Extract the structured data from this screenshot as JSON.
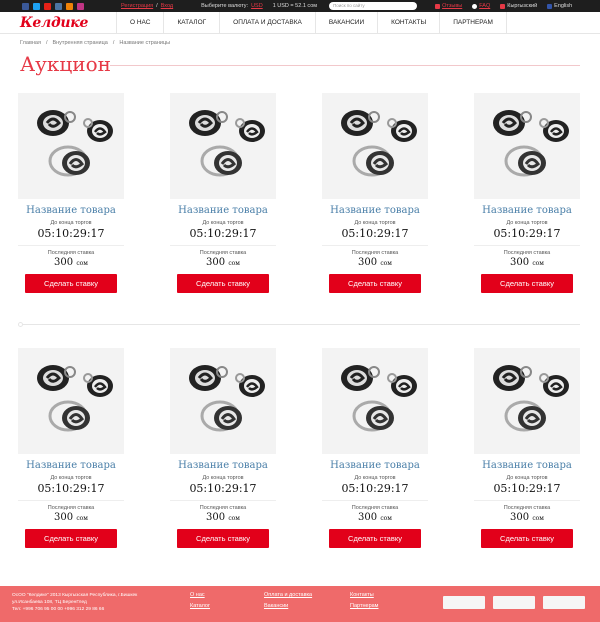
{
  "topbar": {
    "social_icons": [
      "facebook-icon",
      "twitter-icon",
      "youtube-icon",
      "vk-icon",
      "odnoklassniki-icon",
      "instagram-icon"
    ],
    "register": "Регистрация",
    "login": "Вход",
    "currency_label": "Выберите валюту:",
    "currency": "USD",
    "rate": "1 USD = 52.1 сом",
    "search_placeholder": "Поиск по сайту",
    "reviews": "Отзывы",
    "faq": "FAQ",
    "lang_ru": "Кыргызский",
    "lang_en": "English"
  },
  "nav": {
    "logo": "Келдике",
    "items": [
      "О НАС",
      "КАТАЛОГ",
      "ОПЛАТА И ДОСТАВКА",
      "ВАКАНСИИ",
      "КОНТАКТЫ",
      "ПАРТНЕРАМ"
    ]
  },
  "breadcrumb": [
    "Главная",
    "/",
    "Внутренняя страница",
    "/",
    "Название страницы"
  ],
  "page_title": "Аукцион",
  "products": [
    {
      "name": "Название товара",
      "until_label": "До конца торгов",
      "timer": "05:10:29:17",
      "bid_label": "Последняя ставка",
      "price": "300",
      "currency": "сом",
      "button": "Сделать ставку"
    },
    {
      "name": "Название товара",
      "until_label": "До конца торгов",
      "timer": "05:10:29:17",
      "bid_label": "Последняя ставка",
      "price": "300",
      "currency": "сом",
      "button": "Сделать ставку"
    },
    {
      "name": "Название товара",
      "until_label": "До конца торгов",
      "timer": "05:10:29:17",
      "bid_label": "Последняя ставка",
      "price": "300",
      "currency": "сом",
      "button": "Сделать ставку"
    },
    {
      "name": "Название товара",
      "until_label": "До конца торгов",
      "timer": "05:10:29:17",
      "bid_label": "Последняя ставка",
      "price": "300",
      "currency": "сом",
      "button": "Сделать ставку"
    },
    {
      "name": "Название товара",
      "until_label": "До конца торгов",
      "timer": "05:10:29:17",
      "bid_label": "Последняя ставка",
      "price": "300",
      "currency": "сом",
      "button": "Сделать ставку"
    },
    {
      "name": "Название товара",
      "until_label": "До конца торгов",
      "timer": "05:10:29:17",
      "bid_label": "Последняя ставка",
      "price": "300",
      "currency": "сом",
      "button": "Сделать ставку"
    },
    {
      "name": "Название товара",
      "until_label": "До конца торгов",
      "timer": "05:10:29:17",
      "bid_label": "Последняя ставка",
      "price": "300",
      "currency": "сом",
      "button": "Сделать ставку"
    },
    {
      "name": "Название товара",
      "until_label": "До конца торгов",
      "timer": "05:10:29:17",
      "bid_label": "Последняя ставка",
      "price": "300",
      "currency": "сом",
      "button": "Сделать ставку"
    }
  ],
  "footer": {
    "copyright_1": "ОсОО \"Келдике\" 2013 Кыргызская Республика, г.Бишкек",
    "copyright_2": "ул.Исанбаева 108, ТЦ БеренГлед",
    "copyright_3": "Тел: +996 706 95 00 00  +996 312 29 86 66",
    "col1": [
      "О нас",
      "Каталог"
    ],
    "col2": [
      "Оплата и доставка",
      "Вакансии"
    ],
    "col3": [
      "Контакты",
      "Партнерам"
    ]
  },
  "colors": {
    "accent": "#e2001a",
    "link": "#4a7fa8",
    "footer": "#ef6a6a",
    "topbar": "#1e1e1e"
  }
}
